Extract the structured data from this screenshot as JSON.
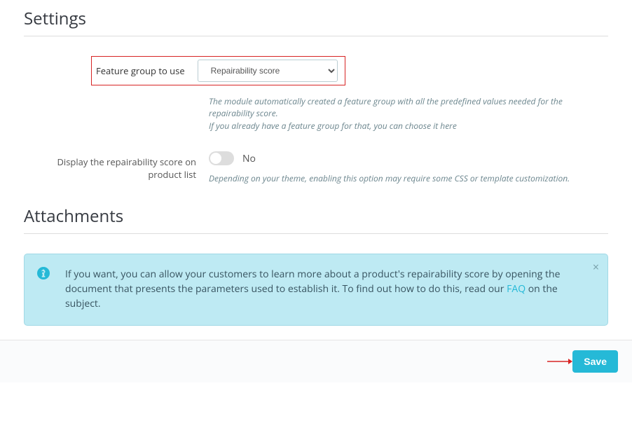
{
  "settings": {
    "title": "Settings",
    "feature_group": {
      "label": "Feature group to use",
      "selected": "Repairability score",
      "help1": "The module automatically created a feature group with all the predefined values needed for the repairability score.",
      "help2": "If you already have a feature group for that, you can choose it here"
    },
    "display_list": {
      "label": "Display the repairability score on product list",
      "value_text": "No",
      "help": "Depending on your theme, enabling this option may require some CSS or template customization."
    }
  },
  "attachments": {
    "title": "Attachments",
    "info_text_pre": "If you want, you can allow your customers to learn more about a product's repairability score by opening the document that presents the parameters used to establish it. To find out how to do this, read our ",
    "info_link": "FAQ",
    "info_text_post": " on the subject."
  },
  "footer": {
    "save": "Save"
  }
}
